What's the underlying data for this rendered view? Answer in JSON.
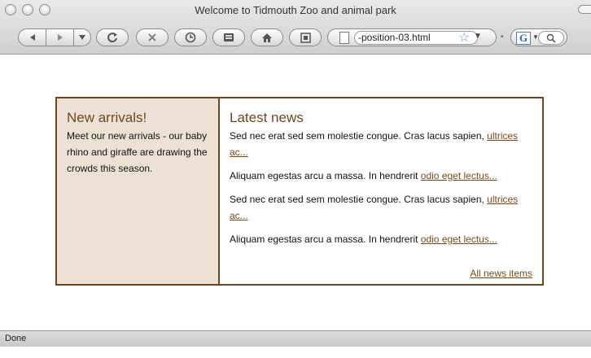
{
  "window": {
    "title": "Welcome to Tidmouth Zoo and animal park"
  },
  "toolbar": {
    "url": "-position-03.html",
    "search_engine_letter": "G"
  },
  "left_panel": {
    "heading": "New arrivals!",
    "text": "Meet our new arrivals - our baby rhino and giraffe are drawing the crowds this season."
  },
  "news": {
    "heading": "Latest news",
    "items": [
      {
        "text": "Sed nec erat sed sem molestie congue. Cras lacus sapien, ",
        "link": "ultrices ac..."
      },
      {
        "text": "Aliquam egestas arcu a massa. In hendrerit ",
        "link": "odio eget lectus..."
      },
      {
        "text": "Sed nec erat sed sem molestie congue. Cras lacus sapien, ",
        "link": "ultrices ac..."
      },
      {
        "text": "Aliquam egestas arcu a massa. In hendrerit ",
        "link": "odio eget lectus..."
      }
    ],
    "all_link": "All news items"
  },
  "status": {
    "text": "Done"
  },
  "icons": {
    "back": "back-arrow-icon",
    "forward": "forward-arrow-icon",
    "reload": "reload-icon",
    "stop": "stop-icon",
    "history": "history-clock-icon",
    "bookmarks": "bookmarks-icon",
    "home": "home-icon",
    "snapback": "snapback-icon",
    "bookmark_star": "star-icon",
    "search": "magnifier-icon"
  },
  "colors": {
    "accent_brown": "#6b4720",
    "left_panel_bg": "#ede1d6",
    "link": "#7a4a1c"
  }
}
